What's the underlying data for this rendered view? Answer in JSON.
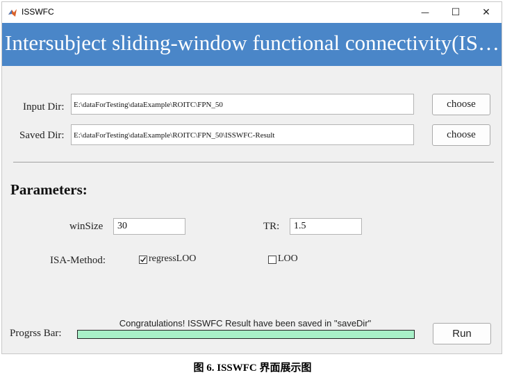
{
  "window": {
    "title": "ISSWFC",
    "app_icon": "matlab-icon",
    "controls": {
      "minimize": "—",
      "maximize": "☐",
      "close": "✕"
    }
  },
  "banner": {
    "title": "Intersubject sliding-window functional connectivity(ISS…",
    "color": "#4a86c8"
  },
  "input_dir": {
    "label": "Input Dir:",
    "value": "E:\\dataForTesting\\dataExample\\ROITC\\FPN_50",
    "button": "choose"
  },
  "saved_dir": {
    "label": "Saved Dir:",
    "value": "E:\\dataForTesting\\dataExample\\ROITC\\FPN_50\\ISSWFC-Result",
    "button": "choose"
  },
  "parameters": {
    "heading": "Parameters:",
    "winsize": {
      "label": "winSize",
      "value": "30"
    },
    "tr": {
      "label": "TR:",
      "value": "1.5"
    },
    "isa_method": {
      "label": "ISA-Method:",
      "options": [
        {
          "label": "regressLOO",
          "checked": true
        },
        {
          "label": "LOO",
          "checked": false
        }
      ]
    }
  },
  "progress": {
    "label": "Progrss Bar:",
    "status": "Congratulations! ISSWFC Result have been saved in \"saveDir\"",
    "fraction": 1.0,
    "fill_color": "#a8f0c8"
  },
  "run_button": "Run",
  "caption": "图 6. ISSWFC 界面展示图"
}
